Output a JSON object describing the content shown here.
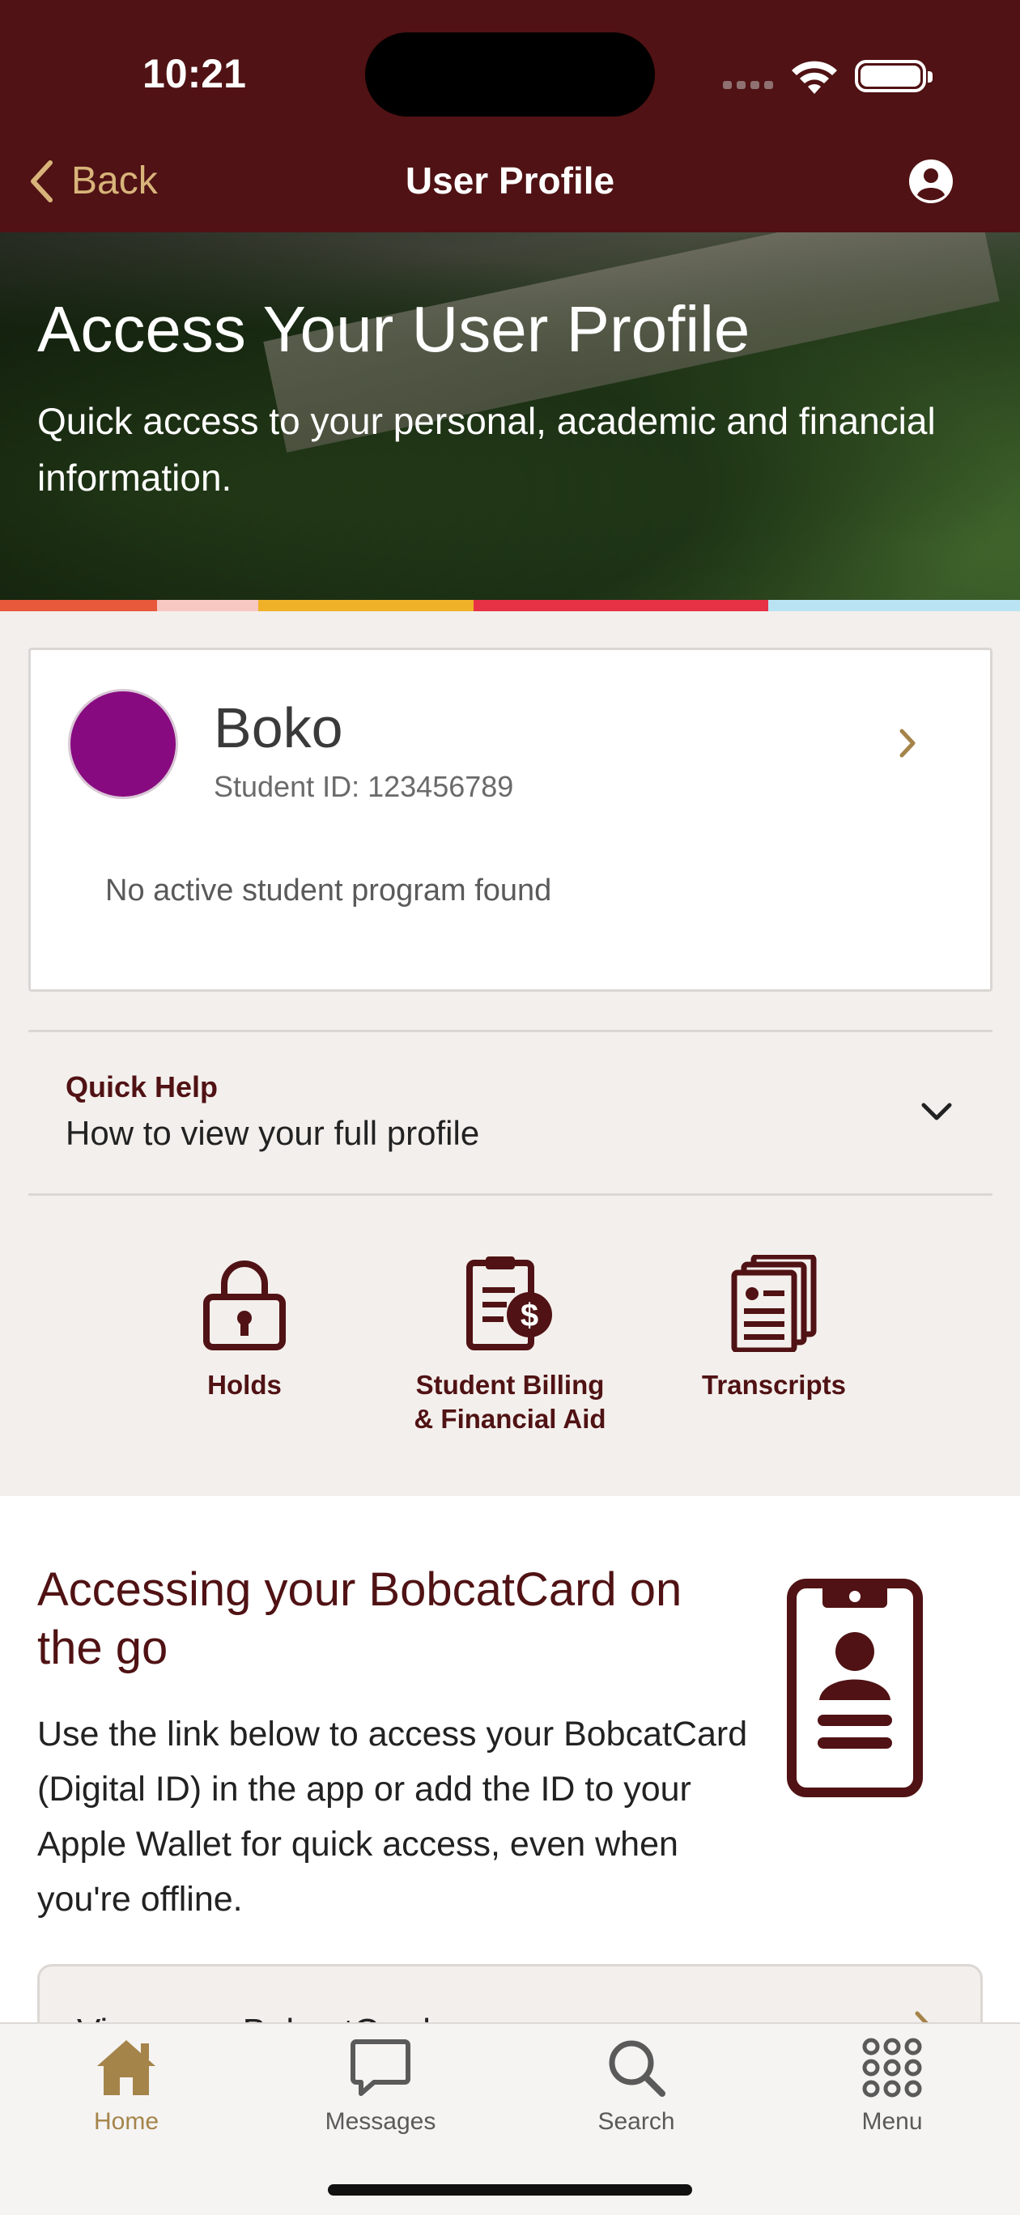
{
  "status_bar": {
    "time": "10:21"
  },
  "nav": {
    "back_label": "Back",
    "title": "User Profile"
  },
  "hero": {
    "title": "Access Your User Profile",
    "subtitle": "Quick access to your personal, academic and financial information."
  },
  "stripe_colors": [
    "#e8583b",
    "#f7c7c1",
    "#efb127",
    "#e73145",
    "#b9e3f3"
  ],
  "profile_card": {
    "name": "Boko",
    "student_id": "Student ID: 123456789",
    "program_status": "No active student program found",
    "avatar_color": "#880a80"
  },
  "quick_help": {
    "label": "Quick Help",
    "title": "How to view your full profile"
  },
  "actions": [
    {
      "label": "Holds",
      "icon": "lock-icon"
    },
    {
      "label": "Student Billing & Financial Aid",
      "icon": "billing-icon"
    },
    {
      "label": "Transcripts",
      "icon": "transcripts-icon"
    }
  ],
  "bobcatcard": {
    "title": "Accessing your BobcatCard on the go",
    "body": "Use the link below to access your BobcatCard (Digital ID) in the app or add the ID to your Apple Wallet for quick access, even when you're offline.",
    "link_label": "View your BobcatCard"
  },
  "tabs": [
    {
      "label": "Home",
      "icon": "home-icon",
      "active": true
    },
    {
      "label": "Messages",
      "icon": "messages-icon",
      "active": false
    },
    {
      "label": "Search",
      "icon": "search-icon",
      "active": false
    },
    {
      "label": "Menu",
      "icon": "grid-menu-icon",
      "active": false
    }
  ],
  "colors": {
    "maroon": "#501214",
    "gold": "#a5844a",
    "background": "#f3efec"
  }
}
